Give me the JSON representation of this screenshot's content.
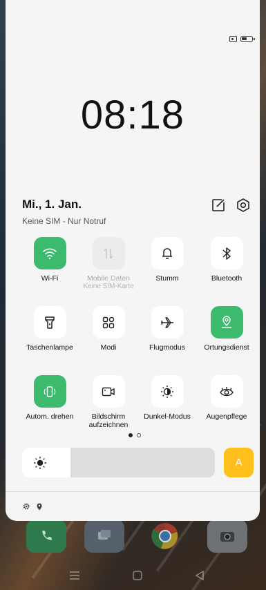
{
  "status_bar": {
    "icons": [
      "sim-icon",
      "battery-icon"
    ]
  },
  "clock": {
    "time": "08:18"
  },
  "header": {
    "date": "Mi., 1. Jan.",
    "sim_status": "Keine SIM - Nur Notruf",
    "edit_icon": "edit-icon",
    "settings_icon": "settings-icon"
  },
  "tiles": [
    {
      "label": "Wi-Fi",
      "icon": "wifi-icon",
      "state": "on"
    },
    {
      "label": "Mobile Daten",
      "sublabel": "Keine SIM-Karte",
      "icon": "mobile-data-icon",
      "state": "disabled"
    },
    {
      "label": "Stumm",
      "icon": "bell-icon",
      "state": "off"
    },
    {
      "label": "Bluetooth",
      "icon": "bluetooth-icon",
      "state": "off"
    },
    {
      "label": "Taschenlampe",
      "icon": "flashlight-icon",
      "state": "off"
    },
    {
      "label": "Modi",
      "icon": "modes-icon",
      "state": "off"
    },
    {
      "label": "Flugmodus",
      "icon": "airplane-icon",
      "state": "off"
    },
    {
      "label": "Ortungsdienst",
      "icon": "location-icon",
      "state": "on"
    },
    {
      "label": "Autom. drehen",
      "icon": "auto-rotate-icon",
      "state": "on"
    },
    {
      "label": "Bildschirm aufzeichnen",
      "icon": "screen-record-icon",
      "state": "off"
    },
    {
      "label": "Dunkel-Modus",
      "icon": "dark-mode-icon",
      "state": "off"
    },
    {
      "label": "Augenpflege",
      "icon": "eye-care-icon",
      "state": "off"
    }
  ],
  "pager": {
    "pages": 2,
    "current": 1
  },
  "brightness": {
    "level_percent": 25,
    "auto_label": "A",
    "accent": "#ffc01e"
  },
  "colors": {
    "tile_on": "#3cba6d",
    "panel_bg": "#f5f5f5"
  },
  "home": {
    "dock_icons": [
      "phone-icon",
      "messages-icon",
      "chrome-icon",
      "camera-icon"
    ],
    "nav": [
      "menu-icon",
      "home-icon",
      "back-icon"
    ]
  }
}
